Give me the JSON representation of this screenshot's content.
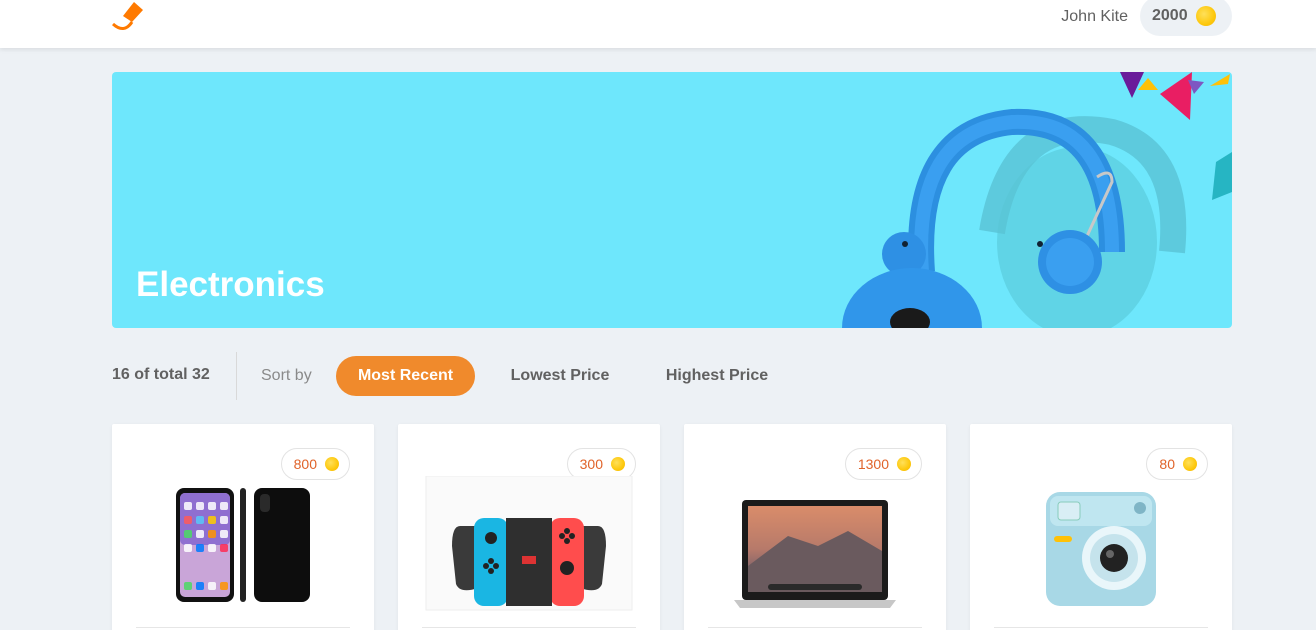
{
  "header": {
    "logo_icon": "kite-logo-icon",
    "user_name": "John Kite",
    "points": "2000",
    "coin_icon": "coin-icon"
  },
  "banner": {
    "title": "Electronics",
    "background_color": "#6ee7fc",
    "image_icon": "headphones-image"
  },
  "sort_bar": {
    "count_text": "16 of total 32",
    "sort_label": "Sort by",
    "options": [
      "Most Recent",
      "Lowest Price",
      "Highest Price"
    ],
    "active_option": "Most Recent",
    "accent_color": "#f08a2c"
  },
  "products": [
    {
      "price": "800",
      "image_icon": "iphone-image"
    },
    {
      "price": "300",
      "image_icon": "nintendo-switch-image"
    },
    {
      "price": "1300",
      "image_icon": "macbook-image"
    },
    {
      "price": "80",
      "image_icon": "instant-camera-image"
    }
  ]
}
